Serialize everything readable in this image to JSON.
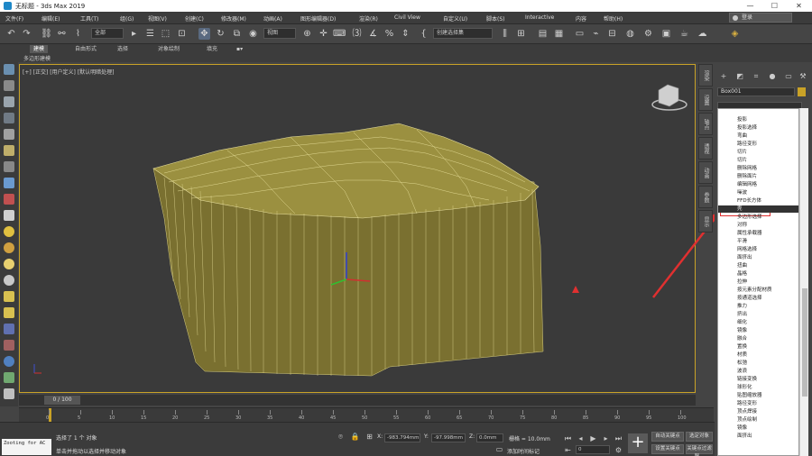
{
  "window": {
    "title": "无标题 - 3ds Max 2019",
    "minimize": "—",
    "maximize": "☐",
    "close": "✕"
  },
  "menu": {
    "items": [
      "文件(F)",
      "编辑(E)",
      "工具(T)",
      "组(G)",
      "视图(V)",
      "创建(C)",
      "修改器(M)",
      "动画(A)",
      "图形编辑器(D)",
      "渲染(R)",
      "Civil View",
      "自定义(U)",
      "脚本(S)",
      "Interactive",
      "内容",
      "帮助(H)"
    ],
    "login": "登录"
  },
  "toolbar": {
    "selection_filter": "全部",
    "view_select": "视图",
    "named_set": "创建选择集"
  },
  "ribbon": {
    "tabs": [
      "建模",
      "自由形式",
      "选择",
      "对象绘制",
      "填充"
    ],
    "subtitle": "多边形建模"
  },
  "viewport": {
    "label": "[+] [正交] [用户定义] [默认明暗处理]"
  },
  "view_strip": [
    "渲染",
    "设置",
    "轴点",
    "透视",
    "动画",
    "参数",
    "显示"
  ],
  "command_panel": {
    "object_name": "Box001",
    "object_color": "#c9a227",
    "modifiers": [
      "投影",
      "投影选择",
      "弯曲",
      "路径变形",
      "切片",
      "切片",
      "删除网格",
      "删除面片",
      "编辑网格",
      "噪波",
      "FFD长方体",
      "壳",
      "多边形选择",
      "对称",
      "属性承载器",
      "平滑",
      "网格选择",
      "面挤出",
      "扭曲",
      "晶格",
      "拉伸",
      "按元素分配材质",
      "按通道选择",
      "推力",
      "挤出",
      "细化",
      "镜像",
      "融合",
      "置换",
      "材质",
      "松弛",
      "波浪",
      "链接变换",
      "球形化",
      "贴图缩放器",
      "路径变形",
      "顶点焊接",
      "顶点绘制",
      "镜像",
      "面挤出"
    ],
    "highlighted": "壳"
  },
  "timeline": {
    "frame": "0 / 100",
    "ticks": [
      "0",
      "5",
      "10",
      "15",
      "20",
      "25",
      "30",
      "35",
      "40",
      "45",
      "50",
      "55",
      "60",
      "65",
      "70",
      "75",
      "80",
      "85",
      "90",
      "95",
      "100"
    ]
  },
  "status": {
    "maxscript": "Zooting for AC",
    "selected": "选择了 1 个 对象",
    "hint": "单击并拖动以选择并移动对象",
    "x_label": "X:",
    "x_value": "-983.794mm",
    "y_label": "Y:",
    "y_value": "-97.998mm",
    "z_label": "Z:",
    "z_value": "0.0mm",
    "grid": "栅格 = 10.0mm",
    "add_time_tag": "添加时间标记",
    "auto_key": "自动关键点",
    "selected_obj": "选定对象",
    "set_key": "设置关键点",
    "key_filters": "关键点过滤器...",
    "frame_field": "0"
  }
}
